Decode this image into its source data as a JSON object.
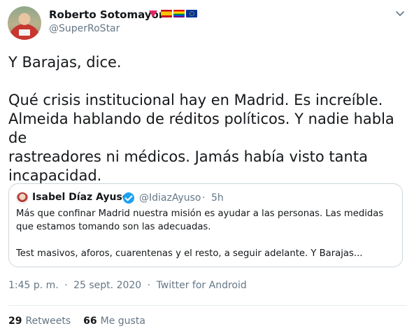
{
  "author": {
    "name": "Roberto Sotomayor",
    "handle": "@SuperRoStar",
    "badges": [
      "heart-triangle-icon",
      "spain-flag-icon",
      "rainbow-flag-icon",
      "eu-flag-icon"
    ]
  },
  "tweet": {
    "text": "Y Barajas, dice.\n\nQué crisis institucional hay en Madrid. Es increíble.\nAlmeida hablando de réditos políticos. Y nadie habla de\nrastreadores ni médicos. Jamás había visto tanta\nincapacidad."
  },
  "quoted": {
    "name": "Isabel Díaz Ayuso",
    "handle": "@IdiazAyuso",
    "separator": "·",
    "time": "5h",
    "text": "Más que confinar Madrid nuestra misión es ayudar a las personas. Las medidas\nque estamos tomando son las adecuadas.\n\nTest masivos, aforos, cuarentenas y el resto, a seguir adelante. Y Barajas..."
  },
  "meta": {
    "time": "1:45 p. m.",
    "separator1": "·",
    "date": "25 sept. 2020",
    "separator2": "·",
    "source": "Twitter for Android"
  },
  "stats": {
    "retweets_count": "29",
    "retweets_label": "Retweets",
    "likes_count": "66",
    "likes_label": "Me gusta"
  },
  "colors": {
    "accent": "#1da1f2",
    "muted": "#657786",
    "border": "#ccd6dd"
  }
}
